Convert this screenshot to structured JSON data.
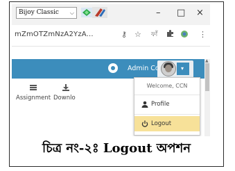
{
  "browser": {
    "ime_selector": "Bijoy Classic",
    "url_fragment": "mZmOTZmNzA2YzA...",
    "window_buttons": {
      "minimize": "–",
      "maximize": "□",
      "close": "×"
    },
    "address_icons": [
      "key-icon",
      "star-icon",
      "bangla-extension-icon",
      "puzzle-icon",
      "extension-icon",
      "menu-dots-icon"
    ],
    "bangla_ext_label": "ফাঁ",
    "menu_dots": "⋮"
  },
  "navbar": {
    "admin_control_label": "Admin Control",
    "admin_caret": "⌄",
    "avatar_caret": "▾",
    "colors": {
      "navbar": "#3c8dbc",
      "logout_highlight": "#f7e199"
    }
  },
  "toolbar": {
    "assignment_label": "Assignment",
    "download_label": "Downlo"
  },
  "dropdown": {
    "welcome": "Welcome, CCN",
    "profile_label": "Profile",
    "logout_label": "Logout"
  },
  "caption": "চিত্র নং-২ঃ Logout অপশন"
}
